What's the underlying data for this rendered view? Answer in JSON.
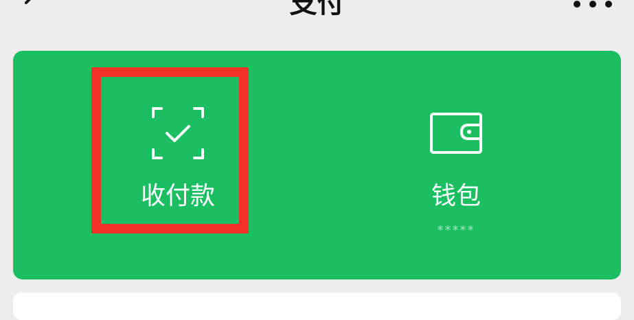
{
  "header": {
    "title": "支付",
    "back_icon": "chevron-left-icon",
    "more_icon": "more-dots-icon"
  },
  "services": {
    "pay": {
      "label": "收付款",
      "icon": "scan-check-icon"
    },
    "wallet": {
      "label": "钱包",
      "sublabel": "*****",
      "icon": "wallet-icon"
    }
  },
  "colors": {
    "card_bg": "#1bbf61",
    "page_bg": "#ededed",
    "highlight": "#f23128"
  }
}
